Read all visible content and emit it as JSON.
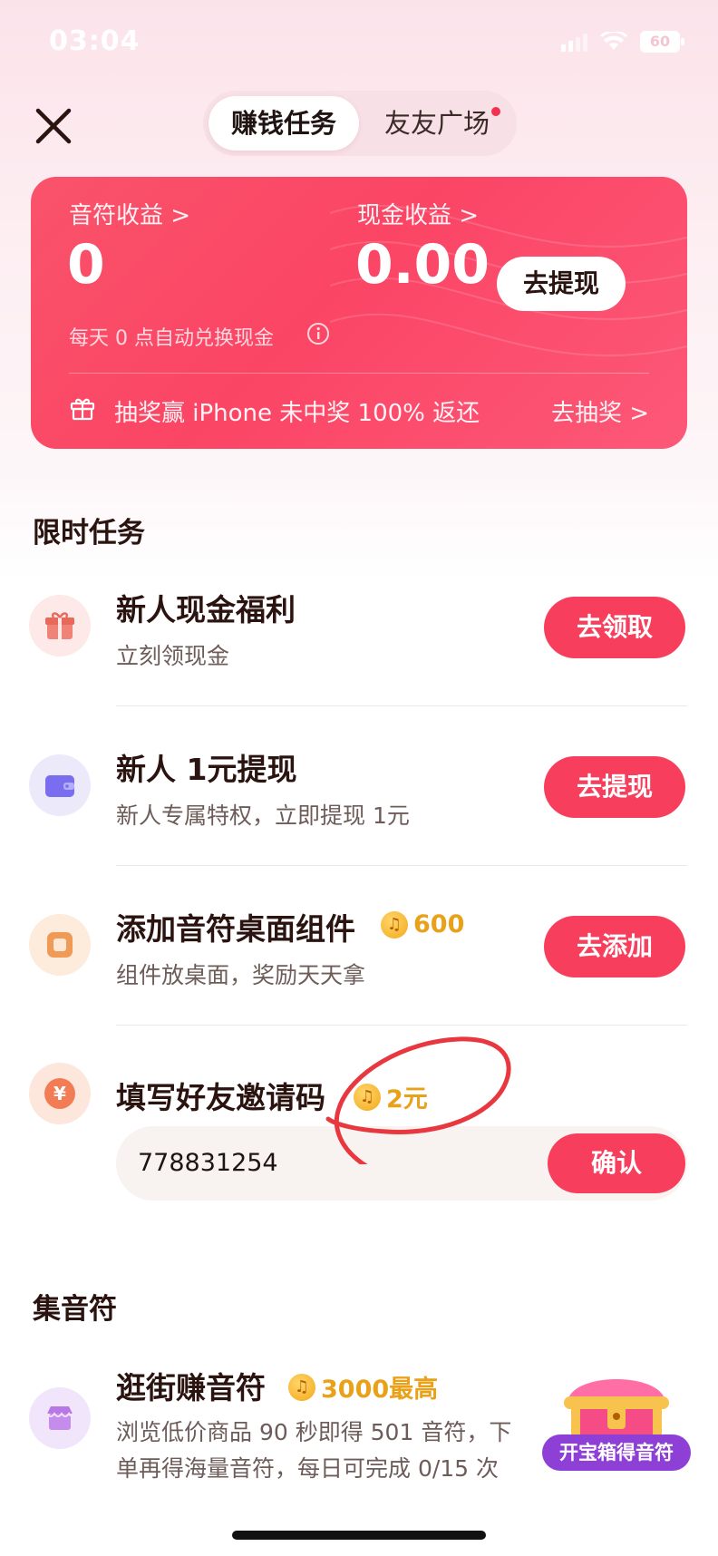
{
  "status_bar": {
    "time": "03:04",
    "battery": "60"
  },
  "tabs": [
    {
      "label": "赚钱任务"
    },
    {
      "label": "友友广场"
    }
  ],
  "earnings_card": {
    "notes_label": "音符收益 >",
    "notes_value": "0",
    "cash_label": "现金收益 >",
    "cash_value": "0.00",
    "withdraw_button": "去提现",
    "auto_exchange_note": "每天 0 点自动兑换现金",
    "lottery_text": "抽奖赢 iPhone 未中奖 100% 返还",
    "lottery_link": "去抽奖 >"
  },
  "limited_tasks": {
    "title": "限时任务",
    "items": [
      {
        "title": "新人现金福利",
        "subtitle": "立刻领现金",
        "button": "去领取",
        "icon": "gift-icon"
      },
      {
        "title": "新人 1元提现",
        "subtitle": "新人专属特权，立即提现 1元",
        "button": "去提现",
        "icon": "wallet-icon"
      },
      {
        "title": "添加音符桌面组件",
        "subtitle": "组件放桌面，奖励天天拿",
        "button": "去添加",
        "reward": "600",
        "icon": "widget-icon"
      },
      {
        "title": "填写好友邀请码",
        "reward": "2元",
        "icon": "yuan-icon"
      }
    ],
    "invite_code_value": "778831254",
    "confirm_button": "确认"
  },
  "collect_notes": {
    "title": "集音符",
    "item": {
      "title": "逛街赚音符",
      "reward": "3000最高",
      "subtitle_line1": "浏览低价商品 90 秒即得 501 音符，下",
      "subtitle_line2": "单再得海量音符，每日可完成 0/15 次",
      "icon": "shop-icon"
    }
  },
  "treasure_box": {
    "label": "开宝箱得音符"
  },
  "colors": {
    "accent": "#f73f5d",
    "card": "#fb4565",
    "reward": "#e9a11a",
    "annotation": "#e8373f"
  }
}
